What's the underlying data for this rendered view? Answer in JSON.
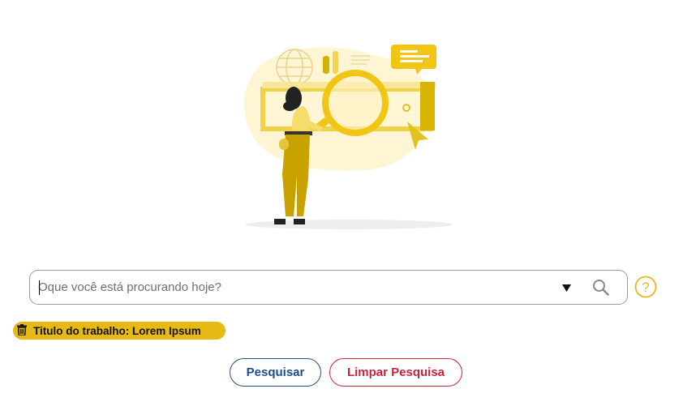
{
  "search": {
    "placeholder": "Oque você está procurando hoje?",
    "value": ""
  },
  "filter_chip": {
    "label": "Titulo do trabalho: Lorem Ipsum"
  },
  "buttons": {
    "search_label": "Pesquisar",
    "clear_label": "Limpar Pesquisa"
  },
  "icons": {
    "dropdown": "caret-down-icon",
    "search": "search-icon",
    "help": "help-icon",
    "trash": "trash-icon"
  },
  "colors": {
    "accent_yellow": "#e7b913",
    "primary_blue": "#1f4e8c",
    "danger_red": "#c9253a",
    "figure_mustard": "#c8a200"
  }
}
